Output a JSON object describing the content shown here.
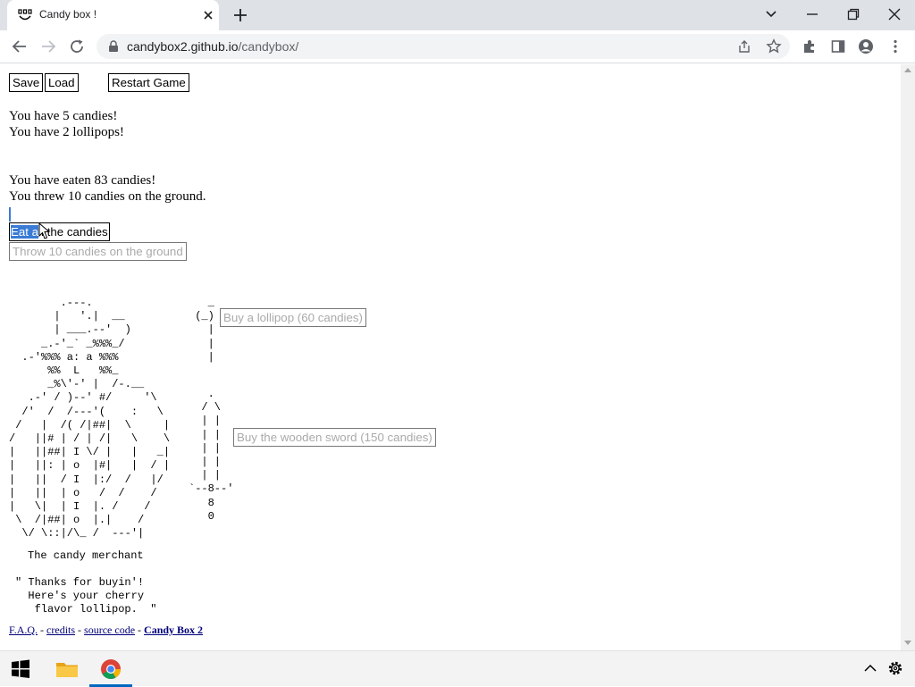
{
  "browser": {
    "tab_title": "Candy box !",
    "url_host": "candybox2.github.io",
    "url_path": "/candybox/"
  },
  "controls": {
    "save_label": "Save",
    "load_label": "Load",
    "restart_label": "Restart Game"
  },
  "status": {
    "candies": "You have 5 candies!",
    "lollipops": "You have 2 lollipops!",
    "eaten": "You have eaten 83 candies!",
    "thrown": "You threw 10 candies on the ground."
  },
  "actions": {
    "eat_selected": "Eat a",
    "eat_rest": "ll the candies",
    "throw_label": "Throw 10 candies on the ground"
  },
  "shop": {
    "lollipop_label": "Buy a lollipop (60 candies)",
    "sword_label": "Buy the wooden sword (150 candies)",
    "merchant_name": "The candy merchant",
    "merchant_speech": "\" Thanks for buyin'!\n  Here's your cherry\n   flavor lollipop.  \""
  },
  "art": {
    "merchant": "        .---.\n       |   '.|  __\n       | ___.--'  )\n     _.-'_` _%%%_/\n  .-'%%% a: a %%%\n      %%  L   %%_\n      _%\\'-' |  /-.__\n   .-' / )--' #/     '\\\n  /'  /  /---'(    :   \\\n /   |  /( /|##|  \\     |\n/   ||# | / | /|   \\    \\\n|   ||##| I \\/ |   |   _|\n|   ||: | o  |#|   |  / |\n|   ||  / I  |:/  /   |/\n|   ||  | o   /  /    /\n|   \\|  | I  |. /    /\n \\  /|##| o  |.|    /\n  \\/ \\::|/\\_ /  ---'|",
    "lollipop": "   _\n (_)\n   |\n   |\n   |",
    "sword": "   .\n  / \\\n  | |\n  | |\n  | |\n  | |\n  | |\n`--8--'\n   8\n   0"
  },
  "footer": {
    "faq": "F.A.Q.",
    "credits": "credits",
    "source": "source code",
    "cb2": "Candy Box 2",
    "sep": " - "
  }
}
